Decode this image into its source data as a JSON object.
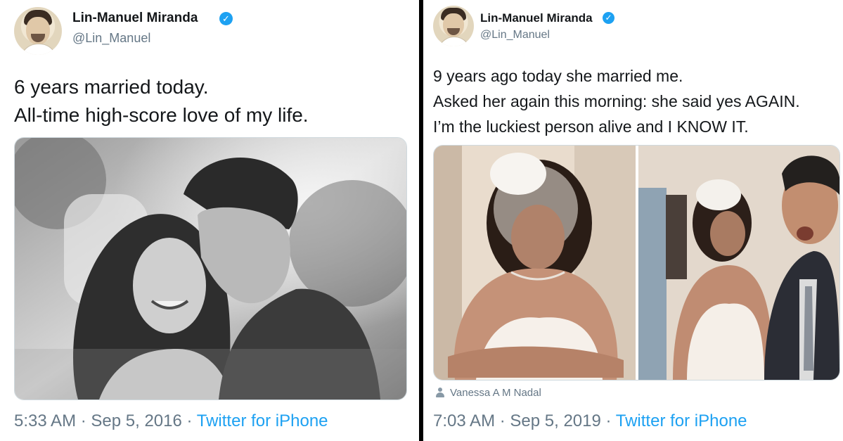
{
  "left_tweet": {
    "author_name": "Lin-Manuel Miranda",
    "handle": "@Lin_Manuel",
    "verified_icon": "verified-badge-icon",
    "text_lines": [
      "6 years married today.",
      "All-time high-score love of my life."
    ],
    "time": "5:33 AM",
    "date": "Sep 5, 2016",
    "separator": "·",
    "source": "Twitter for iPhone"
  },
  "right_tweet": {
    "author_name": "Lin-Manuel Miranda",
    "handle": "@Lin_Manuel",
    "verified_icon": "verified-badge-icon",
    "text_lines": [
      "9 years ago today she married me.",
      "Asked her again this morning: she said yes AGAIN.",
      "I’m the luckiest person alive and I KNOW IT."
    ],
    "tagged_user": "Vanessa A M Nadal",
    "time": "7:03 AM",
    "date": "Sep 5, 2019",
    "separator": "·",
    "source": "Twitter for iPhone"
  },
  "colors": {
    "accent": "#1da1f2",
    "text_primary": "#14171a",
    "text_secondary": "#657786",
    "divider": "#000000"
  }
}
